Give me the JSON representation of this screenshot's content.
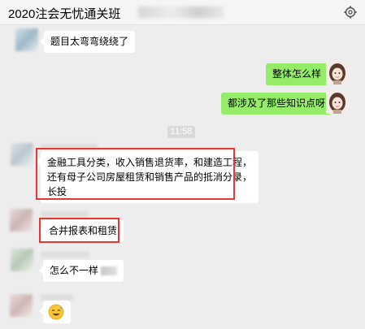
{
  "window": {
    "title": "2020注会无忧通关班"
  },
  "icons": {
    "settings": "settings-icon",
    "emoji": "sweat-smile-emoji"
  },
  "colors": {
    "bubble_out": "#95ec69",
    "bubble_in": "#ffffff",
    "highlight": "#e53935"
  },
  "messages": [
    {
      "side": "left",
      "text": "题目太弯弯绕绕了"
    },
    {
      "side": "right",
      "text": "整体怎么样"
    },
    {
      "side": "right",
      "text": "都涉及了那些知识点呀"
    },
    {
      "side": "left",
      "lines": [
        "金融工具分类，收入销售退货率，和建造工程，",
        "还有母子公司房屋租赁和销售产品的抵消分录，",
        "长投"
      ]
    },
    {
      "side": "left",
      "text": "合并报表和租赁"
    },
    {
      "side": "left",
      "text": "怎么不一样"
    }
  ],
  "timestamp": "11:58"
}
